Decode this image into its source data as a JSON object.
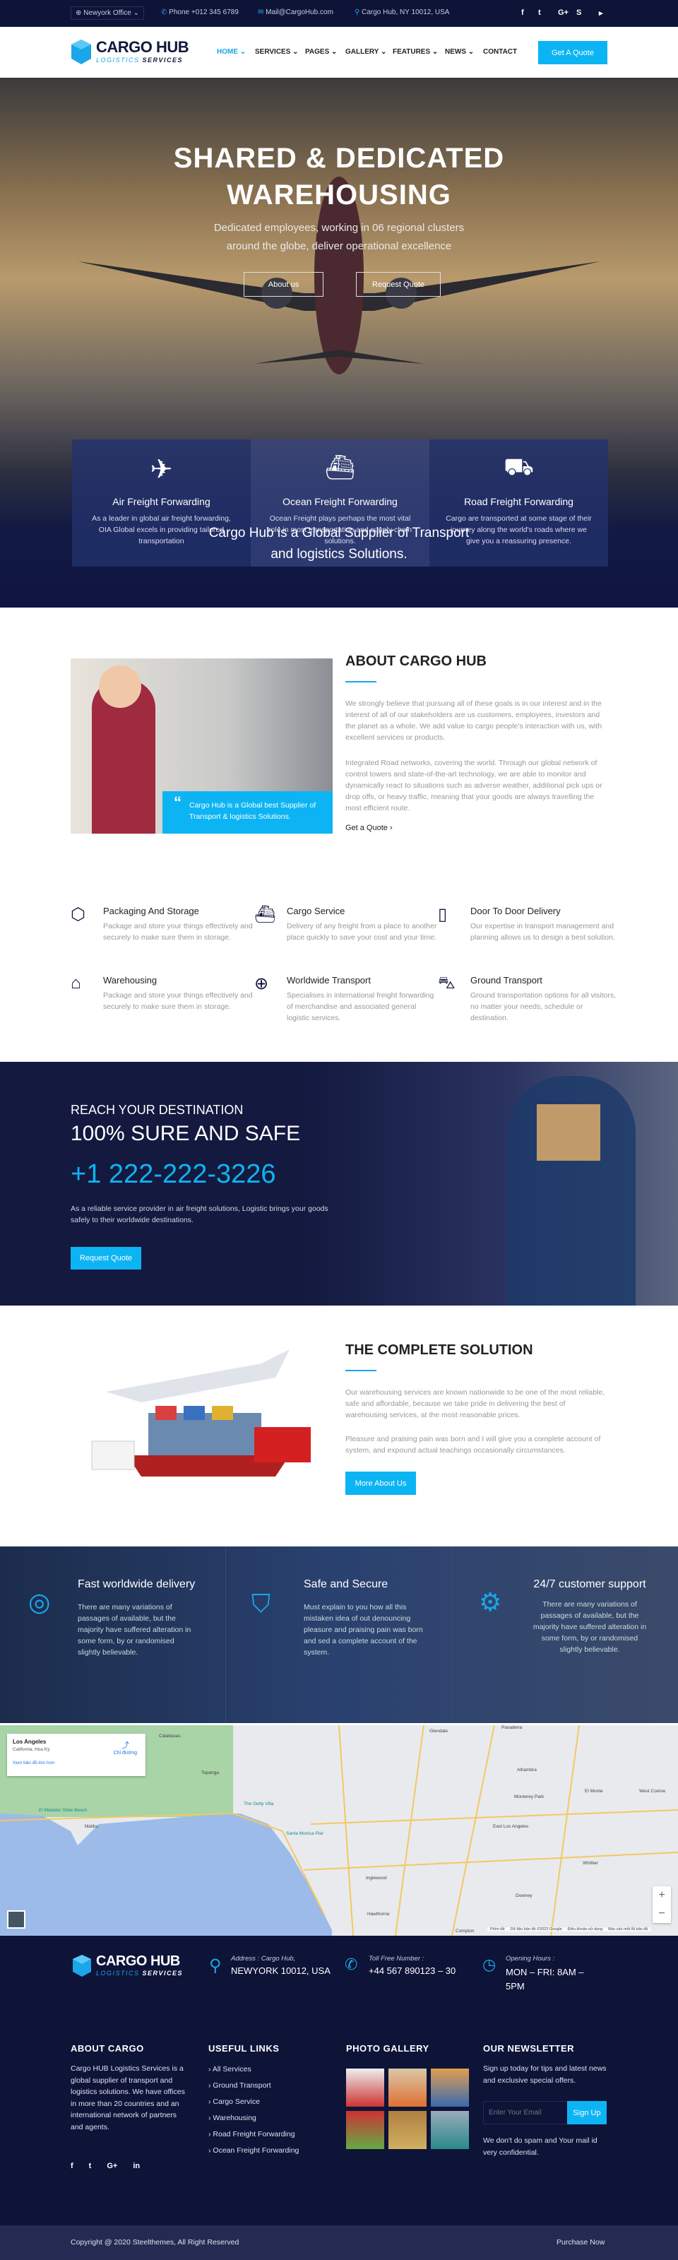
{
  "topbar": {
    "office": "Newyork Office",
    "phone": "Phone +012 345 6789",
    "mail": "Mail@CargoHub.com",
    "address": "Cargo Hub, NY 10012, USA",
    "social": [
      "facebook-icon",
      "twitter-icon",
      "google-plus-icon",
      "skype-icon",
      "youtube-icon"
    ]
  },
  "brand": {
    "name": "CARGO HUB",
    "tagline_a": "LOGISTICS",
    "tagline_b": "SERVICES",
    "accent": "#0db4f3",
    "navy": "#0e1338"
  },
  "nav": {
    "items": [
      "HOME",
      "SERVICES",
      "PAGES",
      "GALLERY",
      "FEATURES",
      "NEWS",
      "CONTACT"
    ],
    "cta": "Get A Quote"
  },
  "hero": {
    "title_1": "SHARED & DEDICATED",
    "title_2": "WAREHOUSING",
    "sub_1": "Dedicated employees, working in 06 regional clusters",
    "sub_2": "around the globe, deliver operational excellence",
    "btn_about": "About us",
    "btn_quote": "Request Quote",
    "cards": [
      {
        "title": "Air Freight Forwarding",
        "text": "As a leader in global air freight forwarding, OIA Global excels in providing tailored transportation"
      },
      {
        "title": "Ocean Freight Forwarding",
        "text": "Ocean Freight plays perhaps the most vital role in most transportation and supply chain solutions."
      },
      {
        "title": "Road Freight Forwarding",
        "text": "Cargo are transported at some stage of their journey along the world's roads where we give you a reassuring presence."
      }
    ],
    "tagline_1": "Cargo Hub is a Global Supplier of Transport",
    "tagline_2": "and logistics Solutions."
  },
  "about": {
    "title": "ABOUT CARGO HUB",
    "p1": "We strongly believe that pursuing all of these goals is in our interest and in the interest of all of our stakeholders are us customers, employees, investors and the planet as a whole. We add value to cargo people's interaction with us, with excellent services or products.",
    "p2": "Integrated Road networks, covering the world. Through our global network of control towers and state-of-the-art technology, we are able to monitor and dynamically react to situations such as adverse weather, additional pick ups or drop offs, or heavy traffic, meaning that your goods are always travelling the most efficient route.",
    "quote": "Cargo Hub is a Global best Supplier of Transport & logistics Solutions.",
    "link": "Get a Quote"
  },
  "features": [
    {
      "icon": "box-icon",
      "title": "Packaging And Storage",
      "text": "Package and store your things effectively and securely to make sure them in storage."
    },
    {
      "icon": "ship-icon",
      "title": "Cargo Service",
      "text": "Delivery of any freight from a place to another place quickly to save your cost and your time."
    },
    {
      "icon": "door-icon",
      "title": "Door To Door Delivery",
      "text": "Our expertise in transport management and planning allows us to design a best solution."
    },
    {
      "icon": "warehouse-icon",
      "title": "Warehousing",
      "text": "Package and store your things effectively and securely to make sure them in storage."
    },
    {
      "icon": "globe-truck-icon",
      "title": "Worldwide Transport",
      "text": "Specialises in international freight forwarding of merchandise and associated general logistic services."
    },
    {
      "icon": "car-icon",
      "title": "Ground Transport",
      "text": "Ground transportation options for all visitors, no matter your needs, schedule or destination."
    }
  ],
  "reach": {
    "kicker": "REACH YOUR DESTINATION",
    "title": "100% SURE AND SAFE",
    "phone": "+1 222-222-3226",
    "text": "As a reliable service provider in air freight solutions, Logistic brings your goods safely to their worldwide destinations.",
    "btn": "Request Quote"
  },
  "solution": {
    "title": "THE COMPLETE SOLUTION",
    "p1": "Our warehousing services are known nationwide to be one of the most reliable, safe and affordable, because we take pride in delivering the best of warehousing services, at the most reasonable prices.",
    "p2": "Pleasure and praising pain was born and I will give you a complete account of system, and expound actual teachings occasionally circumstances.",
    "btn": "More About Us"
  },
  "promises": [
    {
      "icon": "globe-icon",
      "title": "Fast worldwide delivery",
      "text": "There are many variations of passages of available, but the majority have suffered alteration in some form, by or randomised slightly believable."
    },
    {
      "icon": "shield-icon",
      "title": "Safe and Secure",
      "text": "Must explain to you how all this mistaken idea of out denouncing pleasure and praising pain was born and sed a complete account of the system."
    },
    {
      "icon": "support-icon",
      "title": "24/7 customer support",
      "text": "There are many variations of passages of available, but the majority have suffered alteration in some form, by or randomised slightly believable."
    }
  ],
  "map": {
    "place": "Los Angeles",
    "region": "California, Hoa Kỳ",
    "directions": "Chỉ đường",
    "larger": "Xem bản đồ lớn hơn",
    "labels": [
      "Calabasas",
      "Topanga",
      "Malibu",
      "El Matador State Beach",
      "The Getty Villa",
      "Santa Monica Pier",
      "Glendale",
      "Pasadena",
      "Alhambra",
      "Monterey Park",
      "East Los Angeles",
      "Inglewood",
      "Downey",
      "Whittier",
      "West Covina",
      "Compton",
      "Hawthorne",
      "El Monte"
    ],
    "footer": [
      "Phím tắt",
      "Dữ liệu bản đồ ©2023 Google",
      "Điều khoản sử dụng",
      "Báo cáo một lỗi bản đồ"
    ]
  },
  "footer": {
    "address_label": "Address : Cargo Hub,",
    "address": "NEWYORK 10012, USA",
    "phone_label": "Toll Free Number :",
    "phone": "+44 567 890123 – 30",
    "hours_label": "Opening Hours :",
    "hours": "MON – FRI: 8AM – 5PM",
    "about_title": "ABOUT CARGO",
    "about_text": "Cargo HUB Logistics Services is a global supplier of transport and logistics solutions. We have offices in more than 20 countries and an international network of partners and agents.",
    "links_title": "USEFUL LINKS",
    "links": [
      "All Services",
      "Ground Transport",
      "Cargo Service",
      "Warehousing",
      "Road Freight Forwarding",
      "Ocean Freight Forwarding"
    ],
    "gallery_title": "PHOTO GALLERY",
    "news_title": "OUR NEWSLETTER",
    "news_text": "Sign up today for tips and latest news and exclusive special offers.",
    "email_placeholder": "Enter Your Email",
    "signup": "Sign Up",
    "news_note": "We don't do spam and Your mail id very confidential.",
    "social": [
      "facebook-icon",
      "twitter-icon",
      "google-plus-icon",
      "linkedin-icon"
    ],
    "copyright": "Copyright @ 2020 Steelthemes, All Right Reserved",
    "purchase": "Purchase Now"
  }
}
